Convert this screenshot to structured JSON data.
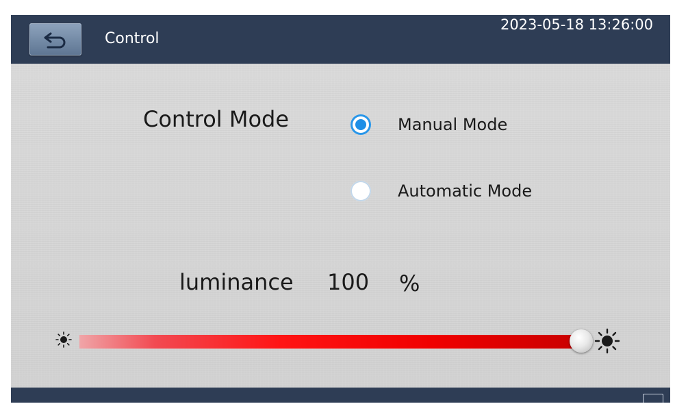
{
  "header": {
    "title": "Control",
    "datetime": "2023-05-18 13:26:00"
  },
  "control_mode": {
    "label": "Control Mode",
    "options": [
      {
        "label": "Manual Mode",
        "selected": true
      },
      {
        "label": "Automatic Mode",
        "selected": false
      }
    ]
  },
  "luminance": {
    "label": "luminance",
    "value": "100",
    "unit": "%",
    "slider_fraction": 1.0
  },
  "icons": {
    "back": "back-arrow-icon",
    "low_brightness": "sun-small-icon",
    "high_brightness": "sun-large-icon"
  },
  "colors": {
    "header": "#2e3d55",
    "radio_selected": "#1e8fe6",
    "slider": "#ff1414"
  }
}
